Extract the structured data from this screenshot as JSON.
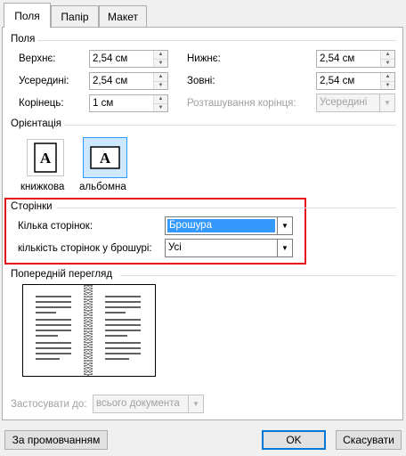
{
  "tabs": [
    {
      "label": "Поля"
    },
    {
      "label": "Папір"
    },
    {
      "label": "Макет"
    }
  ],
  "margins": {
    "title": "Поля",
    "top_label": "Верхнє:",
    "top_value": "2,54 см",
    "bottom_label": "Нижнє:",
    "bottom_value": "2,54 см",
    "inside_label": "Усередині:",
    "inside_value": "2,54 см",
    "outside_label": "Зовні:",
    "outside_value": "2,54 см",
    "gutter_label": "Корінець:",
    "gutter_value": "1 см",
    "gutter_pos_label": "Розташування корінця:",
    "gutter_pos_value": "Усередині"
  },
  "orientation": {
    "title": "Орієнтація",
    "portrait_label": "книжкова",
    "landscape_label": "альбомна",
    "icon_letter": "A"
  },
  "pages": {
    "title": "Сторінки",
    "multiple_label": "Кілька сторінок:",
    "multiple_value": "Брошура",
    "sheets_label": "кількість сторінок у брошурі:",
    "sheets_value": "Усі"
  },
  "preview": {
    "title": "Попередній перегляд"
  },
  "apply": {
    "label": "Застосувати до:",
    "value": "всього документа"
  },
  "buttons": {
    "default": "За промовчанням",
    "ok": "OK",
    "cancel": "Скасувати"
  },
  "colors": {
    "accent": "#0078d7",
    "highlight": "#e8101c",
    "selection": "#3399ff"
  }
}
